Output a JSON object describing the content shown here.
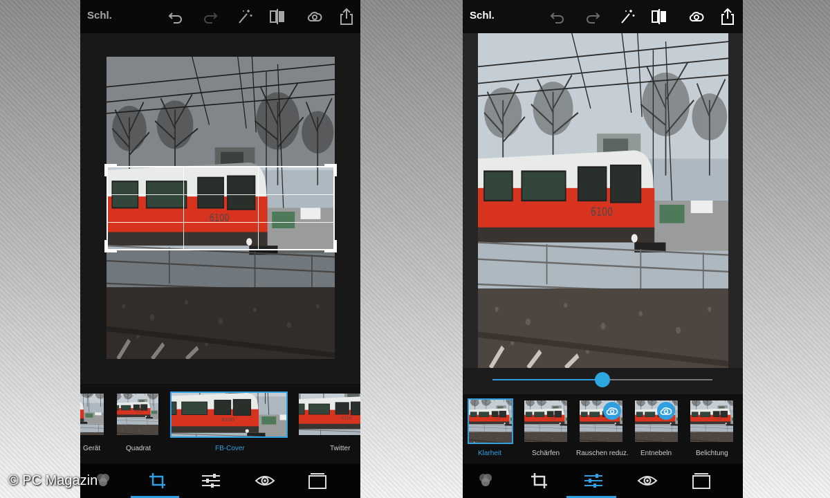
{
  "left_phone": {
    "header": {
      "close_label": "Schl."
    },
    "toolbar_icons": [
      "undo-icon",
      "redo-icon",
      "magic-wand-icon",
      "compare-icon",
      "creative-cloud-icon",
      "share-icon"
    ],
    "crop_presets": [
      {
        "label": "Gerät"
      },
      {
        "label": "Quadrat"
      },
      {
        "label": "FB-Cover",
        "selected": true
      },
      {
        "label": "Twitter"
      }
    ],
    "bottom_tabs": [
      "looks-icon",
      "crop-icon",
      "adjustments-icon",
      "eye-icon",
      "borders-icon"
    ],
    "active_tab": "crop"
  },
  "right_phone": {
    "header": {
      "close_label": "Schl."
    },
    "toolbar_icons": [
      "undo-icon",
      "redo-icon",
      "magic-wand-icon",
      "compare-icon",
      "creative-cloud-icon",
      "share-icon"
    ],
    "slider": {
      "value": 0.5
    },
    "adjustments": [
      {
        "label": "Klarheit",
        "selected": true,
        "cc_badge": false
      },
      {
        "label": "Schärfen",
        "cc_badge": false
      },
      {
        "label": "Rauschen reduz.",
        "cc_badge": true
      },
      {
        "label": "Entnebeln",
        "cc_badge": true
      },
      {
        "label": "Belichtung",
        "cc_badge": false
      }
    ],
    "bottom_tabs": [
      "looks-icon",
      "crop-icon",
      "adjustments-icon",
      "eye-icon",
      "borders-icon"
    ],
    "active_tab": "adjustments"
  },
  "watermark": "© PC Magazin",
  "colors": {
    "accent": "#2f9fe0",
    "train_red": "#d8331e",
    "train_white": "#e9ebe8"
  }
}
